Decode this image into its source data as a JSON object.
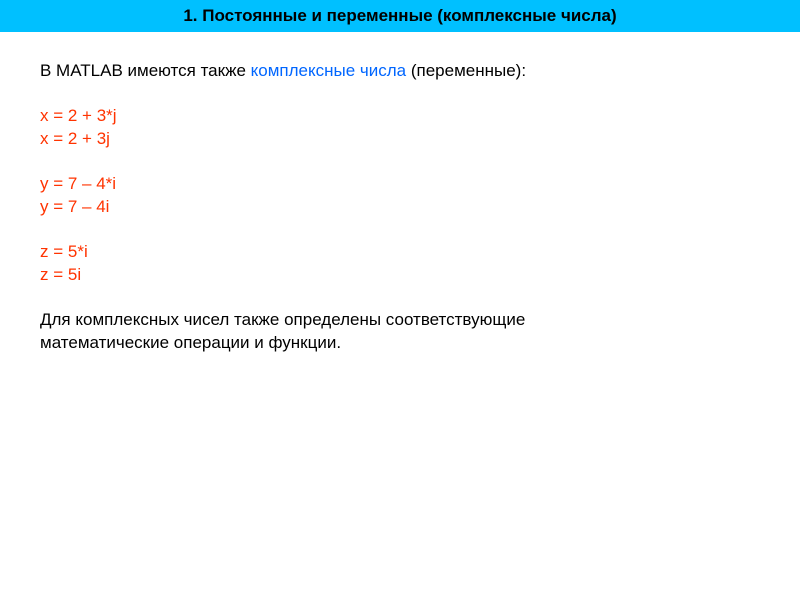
{
  "title": "1. Постоянные и переменные  (комплексные  числа)",
  "intro": {
    "part1": "В MATLAB имеются также ",
    "highlight": "комплексные числа",
    "part2": " (переменные):"
  },
  "codeGroups": [
    {
      "lines": [
        "x = 2 + 3*j",
        "x = 2 + 3j"
      ]
    },
    {
      "lines": [
        "y = 7 – 4*i",
        "y = 7 – 4i"
      ]
    },
    {
      "lines": [
        "z = 5*i",
        "z = 5i"
      ]
    }
  ],
  "footer": {
    "line1": "Для комплексных чисел также определены соответствующие",
    "line2": "математические операции и функции."
  }
}
